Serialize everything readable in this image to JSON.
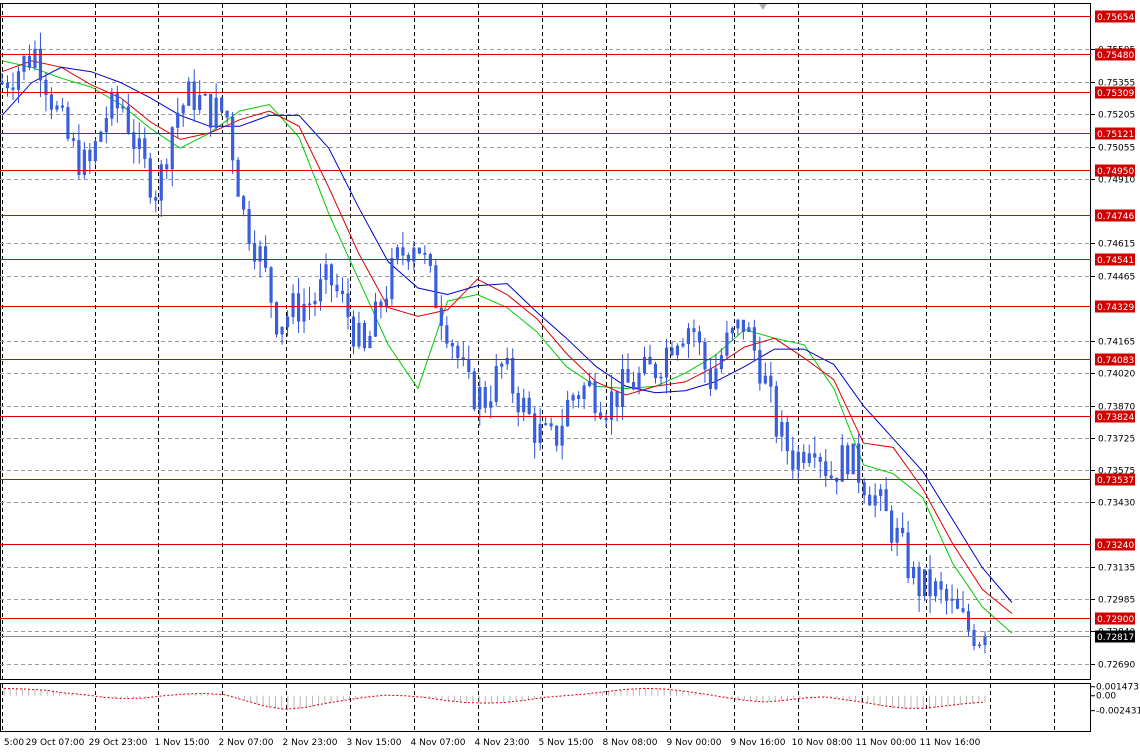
{
  "chart_data": {
    "type": "candlestick",
    "title": "",
    "xlabel": "",
    "ylabel": "",
    "price_range": [
      0.7262,
      0.7571
    ],
    "oscillator_range": [
      -0.0033,
      0.00175
    ],
    "grid": true,
    "x_ticks": [
      "5:00",
      "29 Oct 07:00",
      "29 Oct 23:00",
      "1 Nov 15:00",
      "2 Nov 07:00",
      "2 Nov 23:00",
      "3 Nov 15:00",
      "4 Nov 07:00",
      "4 Nov 23:00",
      "5 Nov 15:00",
      "8 Nov 08:00",
      "9 Nov 00:00",
      "9 Nov 16:00",
      "10 Nov 08:00",
      "11 Nov 00:00",
      "11 Nov 16:00"
    ],
    "y_ticks": [
      "0.75505",
      "0.75355",
      "0.75205",
      "0.75055",
      "0.74910",
      "0.74615",
      "0.74465",
      "0.74165",
      "0.74020",
      "0.73870",
      "0.73725",
      "0.73575",
      "0.73430",
      "0.73135",
      "0.72985",
      "0.72840",
      "0.72690"
    ],
    "oscillator_ticks": [
      "0.001473",
      "0.00",
      "-0.002431"
    ],
    "horizontal_levels": [
      0.75654,
      0.7548,
      0.75309,
      0.75121,
      0.7495,
      0.74746,
      0.74541,
      0.74329,
      0.74083,
      0.73824,
      0.73537,
      0.7324,
      0.729
    ],
    "current_price": "0.72817",
    "series": [
      {
        "name": "",
        "kind": "ma",
        "color": "#00cc00",
        "values": [
          0.7545,
          0.7542,
          0.7537,
          0.7533,
          0.7525,
          0.7514,
          0.7505,
          0.7512,
          0.7522,
          0.7525,
          0.751,
          0.7475,
          0.7445,
          0.7415,
          0.7395,
          0.7435,
          0.7438,
          0.7432,
          0.7421,
          0.7405,
          0.7396,
          0.7395,
          0.7396,
          0.7402,
          0.741,
          0.7422,
          0.7418,
          0.7415,
          0.7395,
          0.736,
          0.7356,
          0.7345,
          0.7315,
          0.7295,
          0.7283
        ]
      },
      {
        "name": "",
        "kind": "ma",
        "color": "#dd0000",
        "values": [
          0.754,
          0.7545,
          0.7542,
          0.7534,
          0.7528,
          0.7517,
          0.7509,
          0.7512,
          0.7518,
          0.7522,
          0.7515,
          0.7487,
          0.7457,
          0.7432,
          0.7428,
          0.7431,
          0.7445,
          0.7438,
          0.7427,
          0.7411,
          0.7398,
          0.7392,
          0.7396,
          0.7398,
          0.7405,
          0.7414,
          0.7418,
          0.7409,
          0.7399,
          0.737,
          0.7368,
          0.7349,
          0.7324,
          0.7303,
          0.7292
        ]
      },
      {
        "name": "",
        "kind": "ma",
        "color": "#0000cc",
        "values": [
          0.752,
          0.7535,
          0.7542,
          0.754,
          0.7535,
          0.7528,
          0.752,
          0.7515,
          0.7515,
          0.752,
          0.752,
          0.7505,
          0.7478,
          0.7453,
          0.7441,
          0.7438,
          0.7442,
          0.7443,
          0.743,
          0.7418,
          0.7405,
          0.7396,
          0.7393,
          0.7394,
          0.7398,
          0.7405,
          0.7413,
          0.7413,
          0.7406,
          0.7387,
          0.7372,
          0.7357,
          0.7335,
          0.7313,
          0.7297
        ]
      }
    ],
    "price_path": [
      0.7535,
      0.7542,
      0.755,
      0.7525,
      0.7505,
      0.7495,
      0.752,
      0.7525,
      0.75,
      0.7485,
      0.752,
      0.753,
      0.7522,
      0.7522,
      0.7475,
      0.7455,
      0.7425,
      0.7432,
      0.7435,
      0.7445,
      0.743,
      0.741,
      0.7435,
      0.7455,
      0.7465,
      0.744,
      0.742,
      0.7395,
      0.739,
      0.7405,
      0.739,
      0.7375,
      0.737,
      0.7392,
      0.7396,
      0.7388,
      0.7395,
      0.74,
      0.7405,
      0.742,
      0.7425,
      0.7398,
      0.7415,
      0.7425,
      0.7405,
      0.7375,
      0.7362,
      0.7375,
      0.7355,
      0.7365,
      0.7353,
      0.734,
      0.7325,
      0.7305,
      0.7303,
      0.7295,
      0.7285,
      0.7281
    ],
    "oscillator": [
      0.0013,
      0.0012,
      0.001,
      0.0005,
      0.0002,
      -0.0003,
      -0.0005,
      -0.0004,
      0,
      0.0003,
      0.0004,
      0.0002,
      -0.0008,
      -0.0018,
      -0.0024,
      -0.0021,
      -0.0014,
      -0.0008,
      -0.0003,
      0.0001,
      0,
      -0.0003,
      -0.0008,
      -0.0012,
      -0.0013,
      -0.0012,
      -0.0008,
      -0.0003,
      0,
      0.0003,
      0.0007,
      0.0011,
      0.0013,
      0.0012,
      0.0008,
      0.0003,
      -0.0003,
      -0.0008,
      -0.0011,
      -0.0008,
      -0.0004,
      -0.0002,
      -0.0007,
      -0.0012,
      -0.0018,
      -0.0022,
      -0.0022,
      -0.0018,
      -0.0014,
      -0.0011
    ]
  }
}
